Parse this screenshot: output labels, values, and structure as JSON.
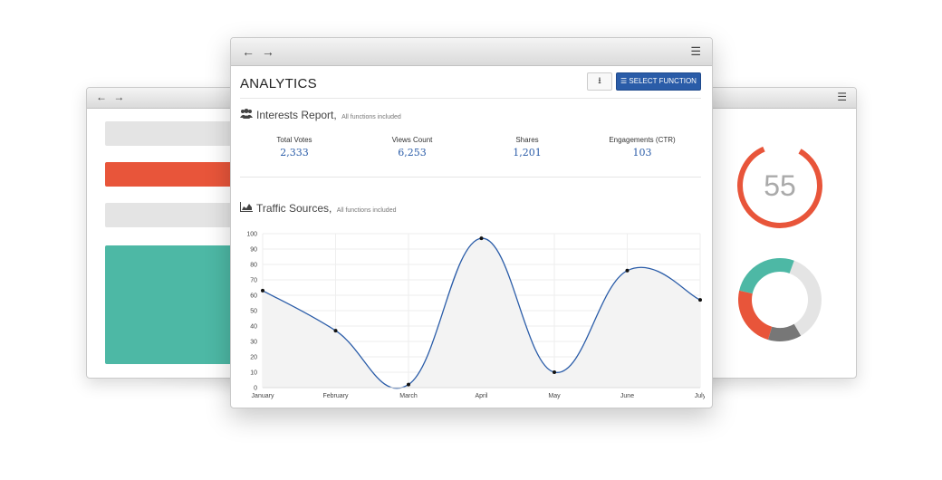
{
  "background_windows": {
    "left": {
      "nav": "← →",
      "menu": "☰",
      "bar_colors": [
        "#e4e4e4",
        "#e8553a",
        "#e4e4e4",
        "#4db8a5"
      ]
    },
    "right": {
      "menu": "☰",
      "gauge_value": "55",
      "gauge_color": "#e8553a",
      "donut_segments": [
        {
          "color": "#e4e4e4",
          "fraction": 0.36
        },
        {
          "color": "#777777",
          "fraction": 0.13
        },
        {
          "color": "#e8553a",
          "fraction": 0.24
        },
        {
          "color": "#4db8a5",
          "fraction": 0.27
        }
      ]
    }
  },
  "main": {
    "nav": "← →",
    "menu": "☰",
    "title": "ANALYTICS",
    "download_icon": "⭳",
    "select_button": "☰ SELECT FUNCTION",
    "interests": {
      "icon": "users-icon",
      "title": "Interests Report,",
      "subtitle": "All functions included",
      "stats": [
        {
          "label": "Total Votes",
          "value": "2,333"
        },
        {
          "label": "Views Count",
          "value": "6,253"
        },
        {
          "label": "Shares",
          "value": "1,201"
        },
        {
          "label": "Engagements (CTR)",
          "value": "103"
        }
      ]
    },
    "traffic": {
      "icon": "area-chart-icon",
      "title": "Traffic Sources,",
      "subtitle": "All functions included"
    }
  },
  "chart_data": {
    "type": "line",
    "categories": [
      "January",
      "February",
      "March",
      "April",
      "May",
      "June",
      "July"
    ],
    "values": [
      63,
      37,
      2,
      97,
      10,
      76,
      57
    ],
    "ylim": [
      0,
      100
    ],
    "yticks": [
      0,
      10,
      20,
      30,
      40,
      50,
      60,
      70,
      80,
      90,
      100
    ],
    "grid": true,
    "line_color": "#2a5ca8",
    "fill_color": "#f3f3f3"
  }
}
